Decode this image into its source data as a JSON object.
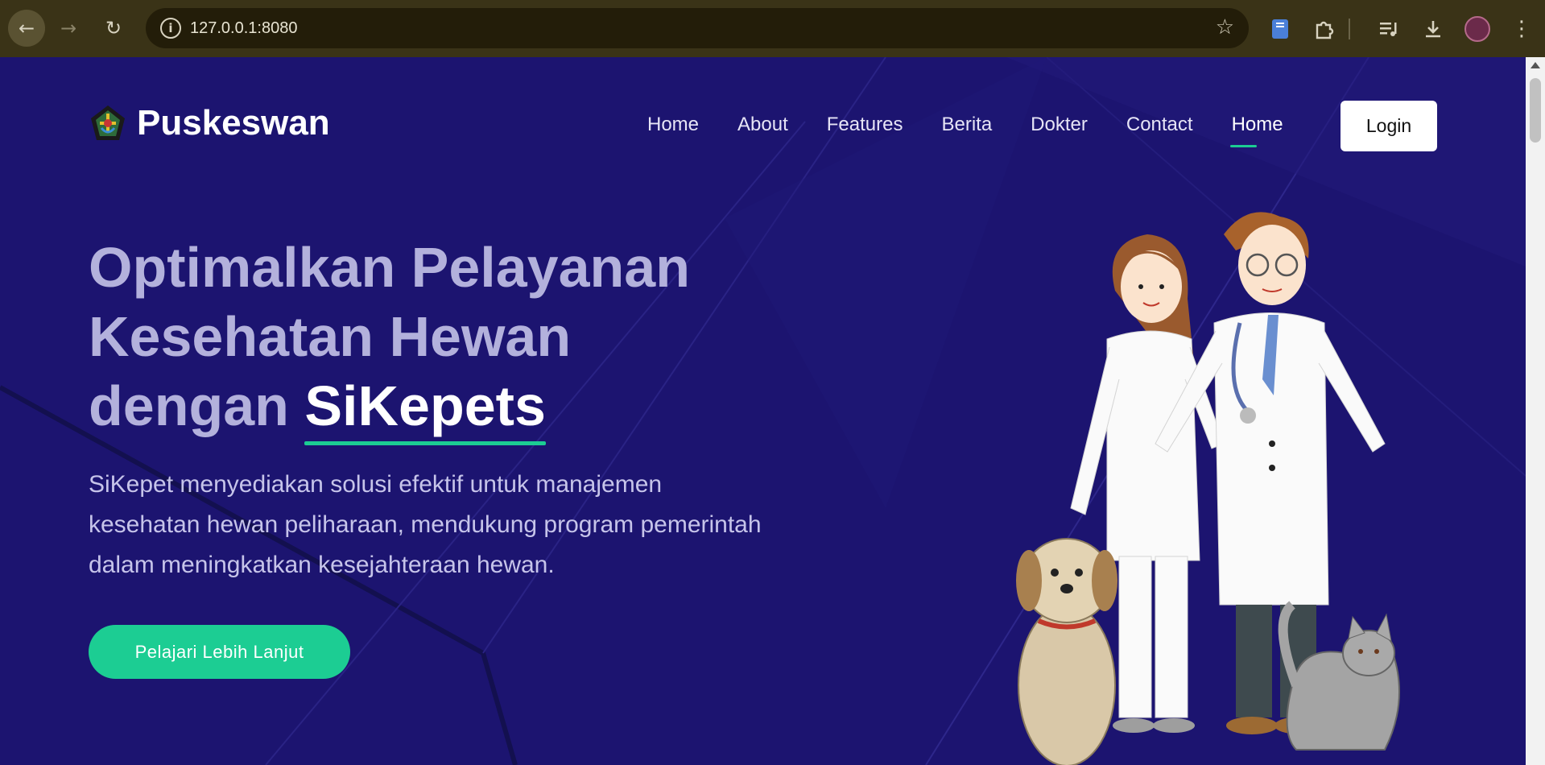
{
  "browser": {
    "url": "127.0.0.1:8080",
    "icons": [
      "back-arrow-icon",
      "forward-arrow-icon",
      "reload-icon",
      "site-info-icon",
      "star-icon",
      "bookmark-icon",
      "extensions-icon",
      "media-icon",
      "download-icon",
      "profile-avatar",
      "menu-icon"
    ]
  },
  "header": {
    "brand": "Puskeswan",
    "nav": [
      "Home",
      "About",
      "Features",
      "Berita",
      "Dokter",
      "Contact",
      "Home"
    ],
    "active_nav": "Home",
    "login_label": "Login"
  },
  "hero": {
    "title_lines": [
      "Optimalkan Pelayanan",
      "Kesehatan Hewan",
      "dengan "
    ],
    "title_highlight": "SiKepets",
    "description": "SiKepet menyediakan solusi efektif untuk manajemen kesehatan hewan peliharaan, mendukung program pemerintah dalam meningkatkan kesejahteraan hewan.",
    "cta_label": "Pelajari Lebih Lanjut"
  },
  "colors": {
    "background": "#1c1470",
    "accent": "#1ccd93",
    "title": "#b3b1dc",
    "chrome": "#3a3317"
  }
}
